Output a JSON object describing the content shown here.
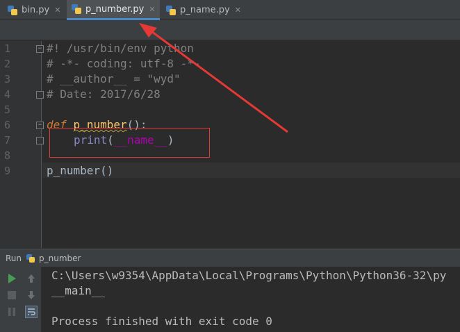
{
  "tabs": [
    {
      "label": "bin.py",
      "active": false
    },
    {
      "label": "p_number.py",
      "active": true
    },
    {
      "label": "p_name.py",
      "active": false
    }
  ],
  "editor": {
    "line_numbers": [
      "1",
      "2",
      "3",
      "4",
      "5",
      "6",
      "7",
      "8",
      "9"
    ],
    "lines": {
      "l1": "#! /usr/bin/env python",
      "l2": "# -*- coding: utf-8 -*-",
      "l3": "# __author__ = \"wyd\"",
      "l4": "# Date: 2017/6/28",
      "l6_kw": "def",
      "l6_fn": "p_number",
      "l6_rest": "():",
      "l7_bi": "print",
      "l7_open": "(",
      "l7_dunder": "__name__",
      "l7_close": ")",
      "l9": "p_number()"
    }
  },
  "run_panel": {
    "title_prefix": "Run",
    "config_name": "p_number",
    "output": [
      "C:\\Users\\w9354\\AppData\\Local\\Programs\\Python\\Python36-32\\py",
      "__main__",
      "",
      "Process finished with exit code 0"
    ]
  },
  "colors": {
    "annotation": "#e53935",
    "active_tab_underline": "#4a88c7"
  },
  "icons": {
    "tab_file": "python-file-icon",
    "tab_close": "close-icon",
    "run": "run-icon",
    "stop": "stop-icon",
    "pause": "pause-icon",
    "up": "arrow-up-icon",
    "down": "arrow-down-icon",
    "soft_wrap": "soft-wrap-icon"
  }
}
